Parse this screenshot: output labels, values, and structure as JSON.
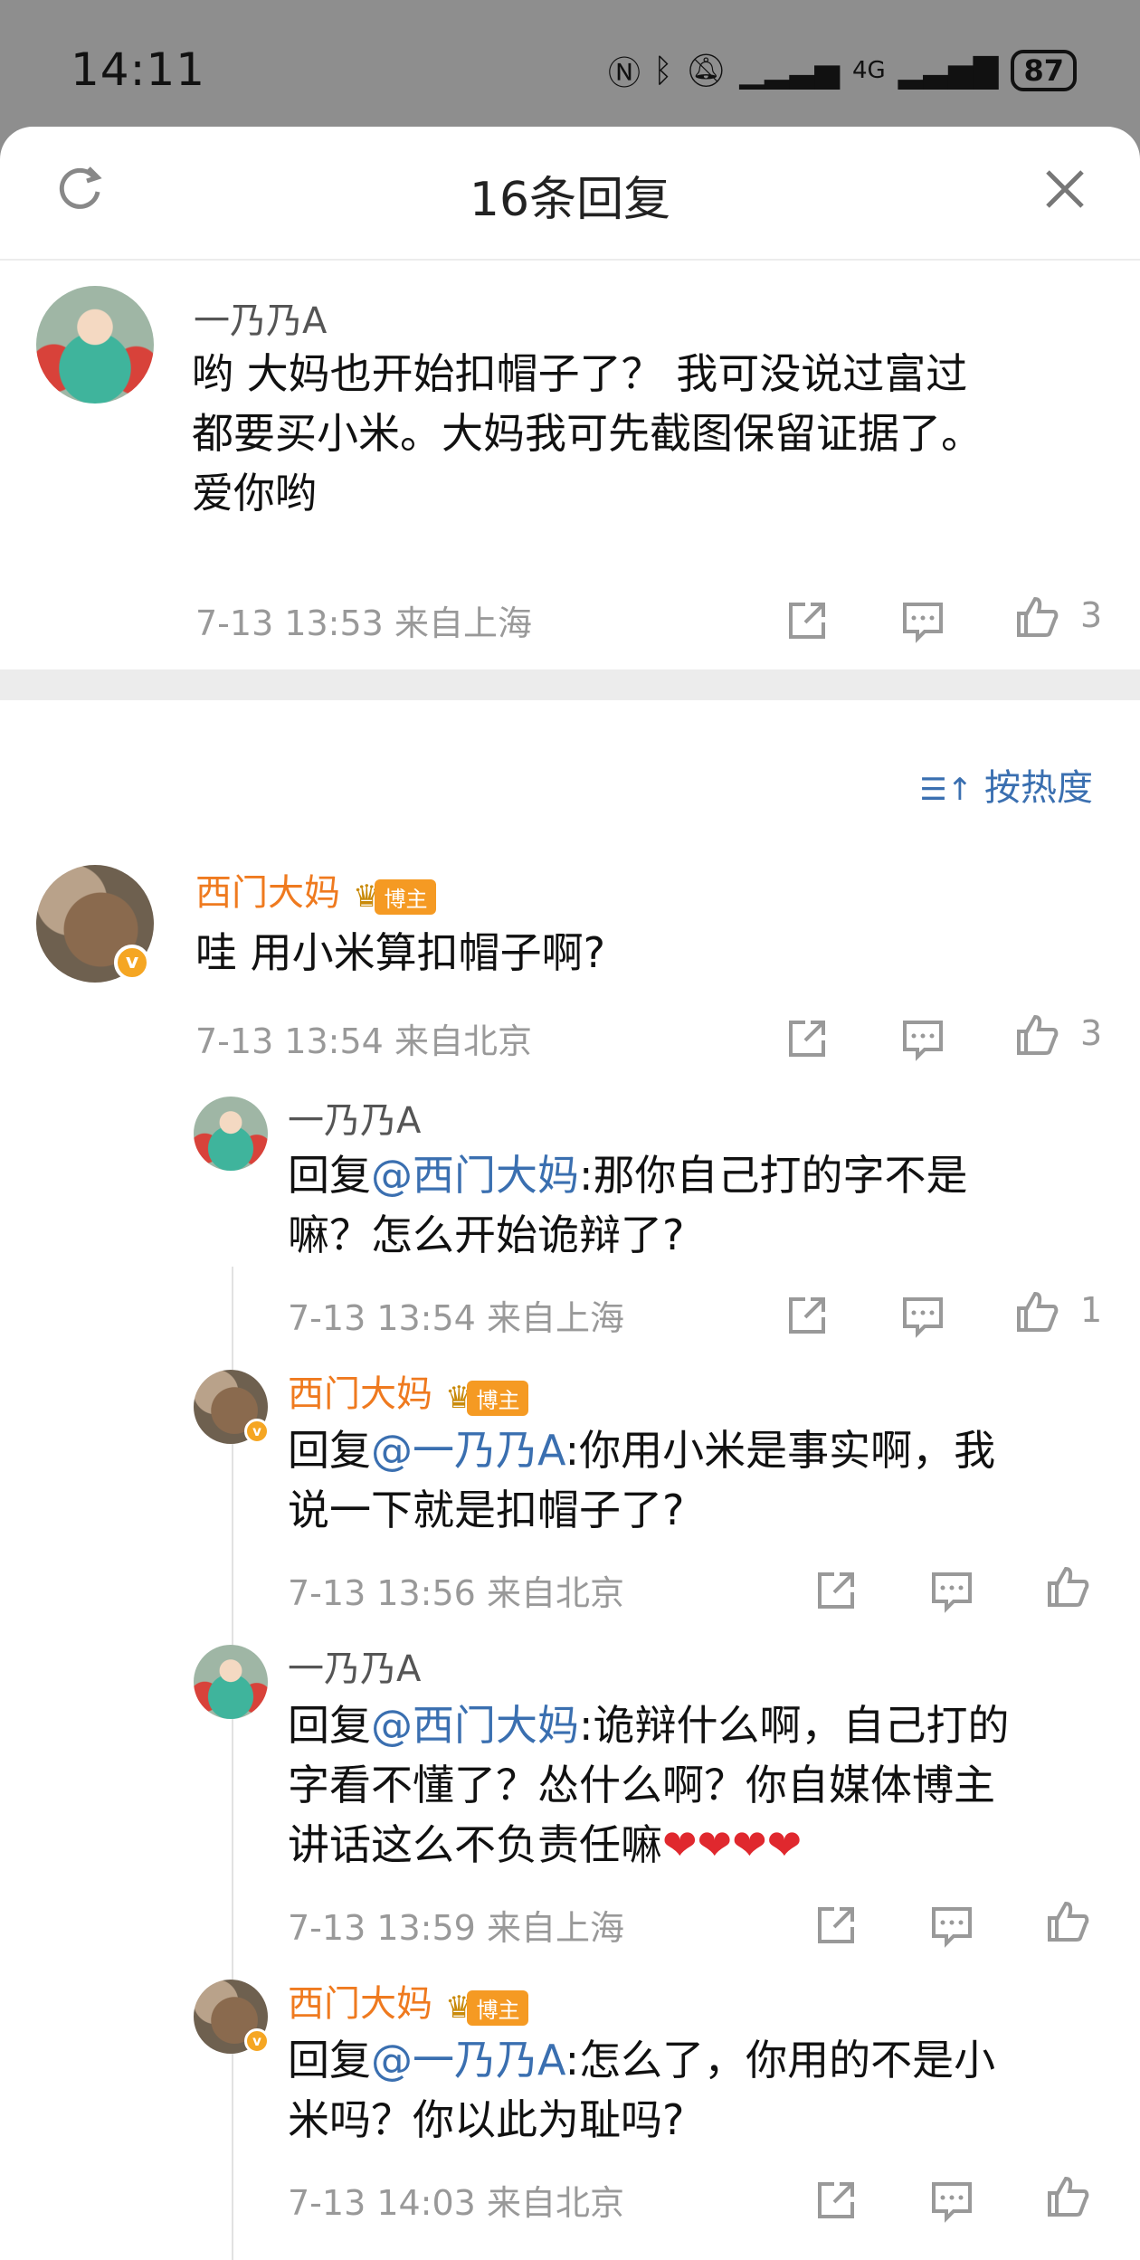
{
  "status_bar": {
    "time": "14:11",
    "network": "4G",
    "battery": "87"
  },
  "header": {
    "title": "16条回复"
  },
  "root_comment": {
    "user": "一乃乃A",
    "text_lines": [
      "哟  大妈也开始扣帽子了？  我可没说过富过",
      "都要买小米。大妈我可先截图保留证据了。",
      "爱你哟"
    ],
    "time": "7-13 13:53",
    "location": "来自上海",
    "likes": "3"
  },
  "sort": {
    "label": "按热度"
  },
  "comments": [
    {
      "user": "西门大妈",
      "badge": "博主",
      "text": "哇 用小米算扣帽子啊?",
      "time": "7-13 13:54",
      "location": "来自北京",
      "likes": "3"
    },
    {
      "user": "一乃乃A",
      "reply_prefix": "回复",
      "mention": "@西门大妈",
      "text_lines": [
        ":那你自己打的字不是",
        "嘛？怎么开始诡辩了?"
      ],
      "time": "7-13 13:54",
      "location": "来自上海",
      "likes": "1"
    },
    {
      "user": "西门大妈",
      "badge": "博主",
      "reply_prefix": "回复",
      "mention": "@一乃乃A",
      "text_lines": [
        ":你用小米是事实啊，我",
        "说一下就是扣帽子了?"
      ],
      "time": "7-13 13:56",
      "location": "来自北京",
      "likes": ""
    },
    {
      "user": "一乃乃A",
      "reply_prefix": "回复",
      "mention": "@西门大妈",
      "text_lines": [
        ":诡辩什么啊，自己打的",
        "字看不懂了？怂什么啊？你自媒体博主",
        "讲话这么不负责任嘛"
      ],
      "hearts": "❤❤❤❤",
      "time": "7-13 13:59",
      "location": "来自上海",
      "likes": ""
    },
    {
      "user": "西门大妈",
      "badge": "博主",
      "reply_prefix": "回复",
      "mention": "@一乃乃A",
      "text_lines": [
        ":怎么了，你用的不是小",
        "米吗？你以此为耻吗?"
      ],
      "time": "7-13 14:03",
      "location": "来自北京",
      "likes": ""
    }
  ]
}
